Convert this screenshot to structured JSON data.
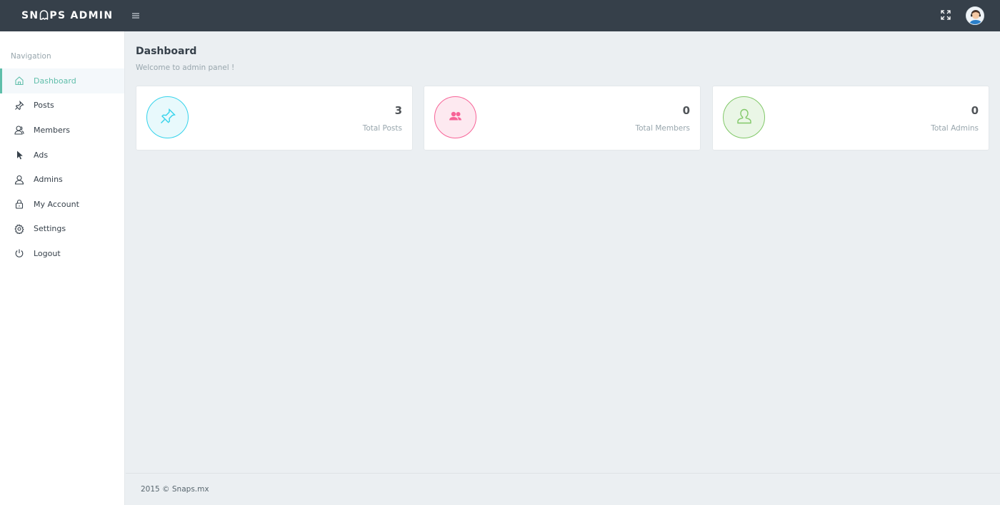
{
  "header": {
    "brand_prefix": "SN",
    "brand_suffix": "PS ADMIN",
    "menu_icon": "hamburger-icon",
    "fullscreen_icon": "expand-icon",
    "avatar_icon": "user-avatar"
  },
  "sidebar": {
    "title": "Navigation",
    "items": [
      {
        "label": "Dashboard",
        "icon": "home-icon",
        "active": true
      },
      {
        "label": "Posts",
        "icon": "pin-icon"
      },
      {
        "label": "Members",
        "icon": "user-group-icon"
      },
      {
        "label": "Ads",
        "icon": "cursor-icon"
      },
      {
        "label": "Admins",
        "icon": "user-icon"
      },
      {
        "label": "My Account",
        "icon": "lock-icon"
      },
      {
        "label": "Settings",
        "icon": "gear-icon"
      },
      {
        "label": "Logout",
        "icon": "power-icon"
      }
    ]
  },
  "page": {
    "title": "Dashboard",
    "subtitle": "Welcome to admin panel !"
  },
  "stats": [
    {
      "value": "3",
      "label": "Total Posts",
      "icon": "pin-icon",
      "color": "#34d3eb"
    },
    {
      "value": "0",
      "label": "Total Members",
      "icon": "users-icon",
      "color": "#f76397"
    },
    {
      "value": "0",
      "label": "Total Admins",
      "icon": "user-icon",
      "color": "#81c868"
    }
  ],
  "footer": {
    "text": "2015 © Snaps.mx"
  },
  "colors": {
    "topbar": "#36404a",
    "accent": "#5fbeaa",
    "background": "#ebeff2"
  }
}
